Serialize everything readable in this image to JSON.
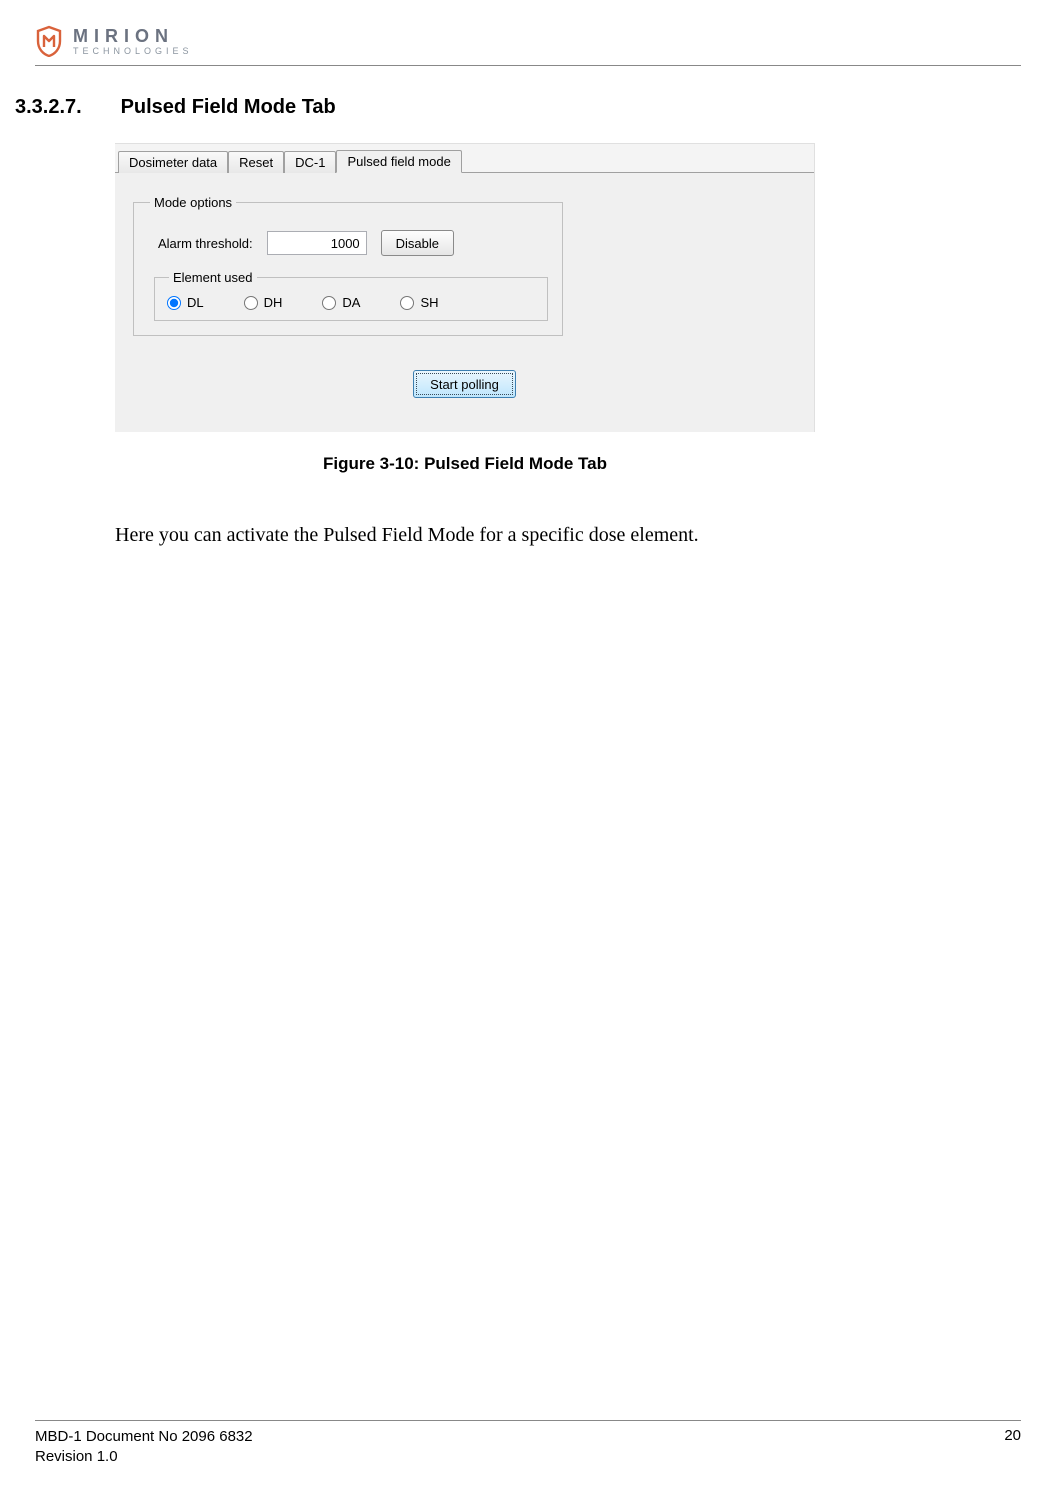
{
  "logo": {
    "main": "MIRION",
    "sub": "TECHNOLOGIES"
  },
  "section": {
    "number": "3.3.2.7.",
    "title": "Pulsed Field Mode Tab"
  },
  "ui": {
    "tabs": [
      "Dosimeter data",
      "Reset",
      "DC-1",
      "Pulsed field mode"
    ],
    "active_tab_index": 3,
    "mode_options_legend": "Mode options",
    "alarm_threshold_label": "Alarm threshold:",
    "alarm_threshold_value": "1000",
    "disable_label": "Disable",
    "element_used_legend": "Element used",
    "elements": [
      "DL",
      "DH",
      "DA",
      "SH"
    ],
    "selected_element_index": 0,
    "start_polling_label": "Start polling"
  },
  "figure_caption": "Figure 3-10: Pulsed Field Mode Tab",
  "body_text": "Here you can activate the Pulsed Field Mode for a specific dose element.",
  "footer": {
    "doc": "MBD-1 Document No 2096 6832",
    "rev": "Revision 1.0",
    "page": "20"
  }
}
